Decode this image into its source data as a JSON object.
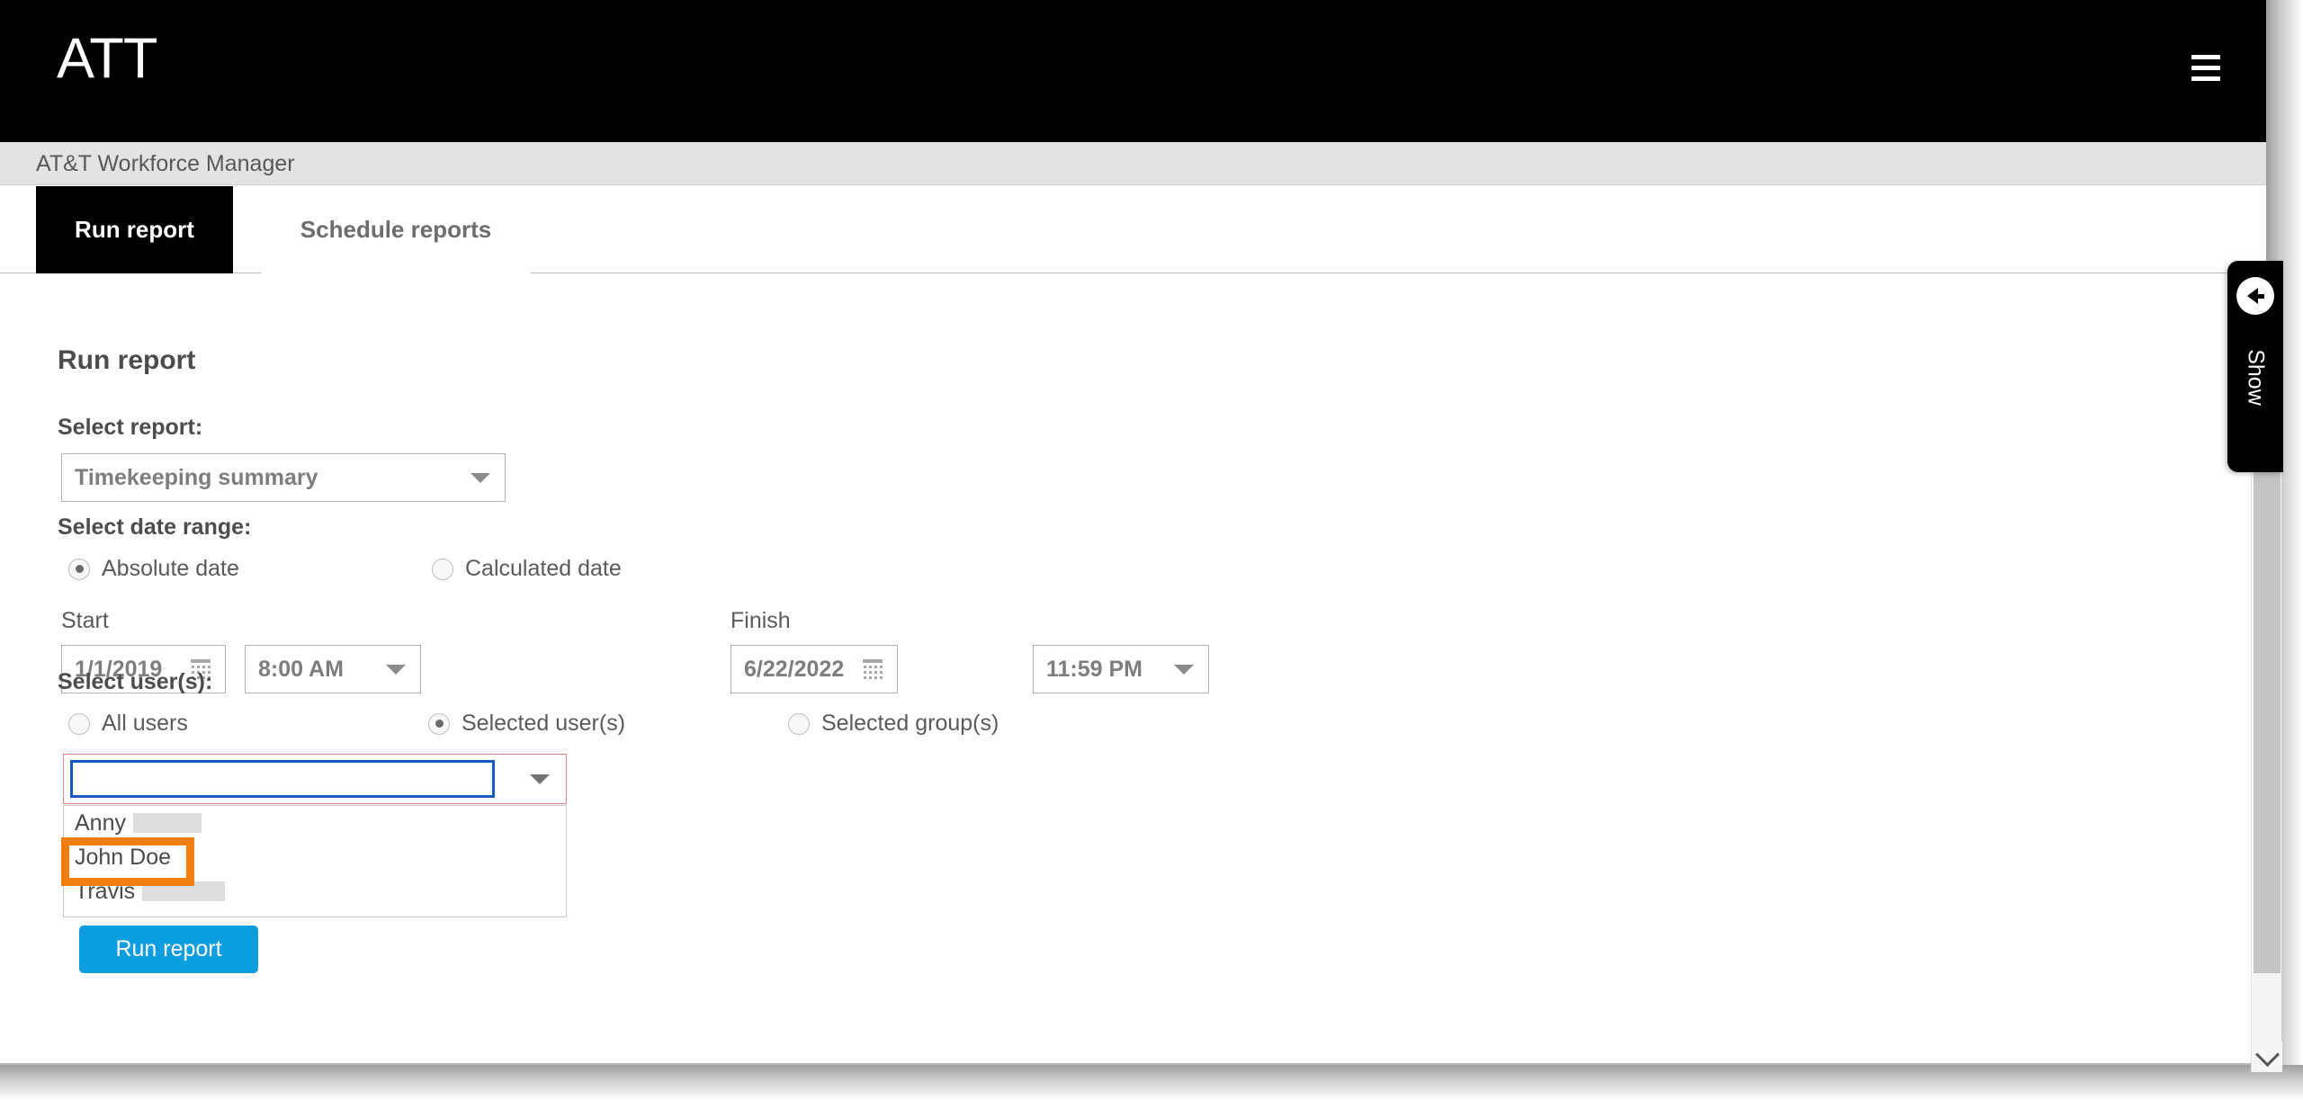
{
  "header": {
    "brand": "ATT",
    "menu_icon": "hamburger-icon",
    "subtitle": "AT&T Workforce Manager",
    "background_color": "#000000"
  },
  "tabs": [
    {
      "label": "Run report",
      "active": true
    },
    {
      "label": "Schedule reports",
      "active": false
    }
  ],
  "main": {
    "heading": "Run report",
    "select_report": {
      "label": "Select report:",
      "value": "Timekeeping summary",
      "caret_icon": "chevron-down-icon"
    },
    "date_range": {
      "label": "Select date range:",
      "options": [
        {
          "label": "Absolute date",
          "selected": true
        },
        {
          "label": "Calculated date",
          "selected": false
        }
      ],
      "start": {
        "label": "Start",
        "date": "1/1/2019",
        "time": "8:00 AM",
        "calendar_icon": "calendar-icon"
      },
      "finish": {
        "label": "Finish",
        "date": "6/22/2022",
        "time": "11:59 PM",
        "calendar_icon": "calendar-icon"
      }
    },
    "select_users": {
      "label": "Select user(s):",
      "options": [
        {
          "label": "All users",
          "selected": false
        },
        {
          "label": "Selected user(s)",
          "selected": true
        },
        {
          "label": "Selected group(s)",
          "selected": false
        }
      ],
      "combobox": {
        "value": "",
        "placeholder": "",
        "caret_icon": "chevron-down-icon",
        "focus_border_color": "#1559c4",
        "validation_border_color": "#e0868a"
      },
      "dropdown_options": [
        {
          "label": "Anny",
          "redacted": true,
          "highlighted": false
        },
        {
          "label": "John Doe",
          "redacted": false,
          "highlighted": true
        },
        {
          "label": "Travis",
          "redacted": true,
          "highlighted": false
        }
      ]
    },
    "submit_button": {
      "label": "Run report",
      "color": "#0c9ddf"
    }
  },
  "side_panel": {
    "show_label": "Show",
    "back_icon": "arrow-left-circle-icon"
  },
  "scrollbar": {
    "up_icon": "chevron-up-icon",
    "down_icon": "chevron-down-icon"
  },
  "annotation": {
    "target": "John Doe",
    "color": "#f07d10"
  }
}
